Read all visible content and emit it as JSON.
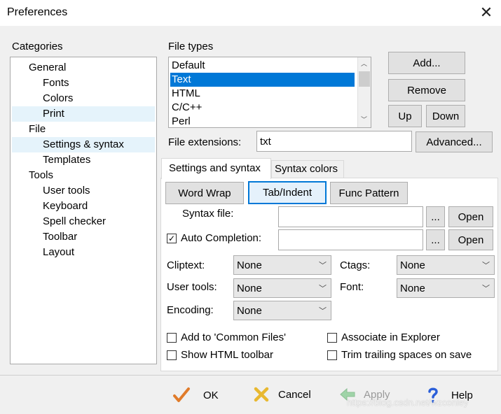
{
  "window": {
    "title": "Preferences"
  },
  "categories": {
    "label": "Categories",
    "items": [
      {
        "label": "General",
        "level": 0
      },
      {
        "label": "Fonts",
        "level": 1
      },
      {
        "label": "Colors",
        "level": 1
      },
      {
        "label": "Print",
        "level": 1
      },
      {
        "label": "File",
        "level": 0
      },
      {
        "label": "Settings & syntax",
        "level": 1
      },
      {
        "label": "Templates",
        "level": 1
      },
      {
        "label": "Tools",
        "level": 0
      },
      {
        "label": "User tools",
        "level": 1
      },
      {
        "label": "Keyboard",
        "level": 1
      },
      {
        "label": "Spell checker",
        "level": 1
      },
      {
        "label": "Toolbar",
        "level": 1
      },
      {
        "label": "Layout",
        "level": 1
      }
    ],
    "selected": "Settings & syntax"
  },
  "file_types": {
    "label": "File types",
    "items": [
      "Default",
      "Text",
      "HTML",
      "C/C++",
      "Perl"
    ],
    "selected": "Text"
  },
  "buttons": {
    "add": "Add...",
    "remove": "Remove",
    "up": "Up",
    "down": "Down",
    "advanced": "Advanced..."
  },
  "file_extensions": {
    "label": "File extensions:",
    "value": "txt"
  },
  "tabs": [
    "Settings and syntax",
    "Syntax colors"
  ],
  "active_tab": "Settings and syntax",
  "settings": {
    "word_wrap": "Word Wrap",
    "tab_indent": "Tab/Indent",
    "func_pattern": "Func Pattern",
    "syntax_file_label": "Syntax file:",
    "syntax_file_value": "",
    "browse": "...",
    "open": "Open",
    "auto_completion_label": "Auto Completion:",
    "auto_completion_checked": true,
    "auto_completion_value": "",
    "cliptext_label": "Cliptext:",
    "cliptext_value": "None",
    "ctags_label": "Ctags:",
    "ctags_value": "None",
    "user_tools_label": "User tools:",
    "user_tools_value": "None",
    "font_label": "Font:",
    "font_value": "None",
    "encoding_label": "Encoding:",
    "encoding_value": "None",
    "add_common_files": "Add to 'Common Files'",
    "associate_explorer": "Associate in Explorer",
    "show_html_toolbar": "Show HTML toolbar",
    "trim_trailing": "Trim trailing spaces on save"
  },
  "footer": {
    "ok": "OK",
    "cancel": "Cancel",
    "apply": "Apply",
    "help": "Help"
  },
  "watermark": "https://blog.csdn.net/wzconley",
  "colors": {
    "selection": "#0078d7",
    "ok_check": "#e07b2a",
    "cancel_x": "#e8b830",
    "help_icon": "#2b5fd9"
  }
}
